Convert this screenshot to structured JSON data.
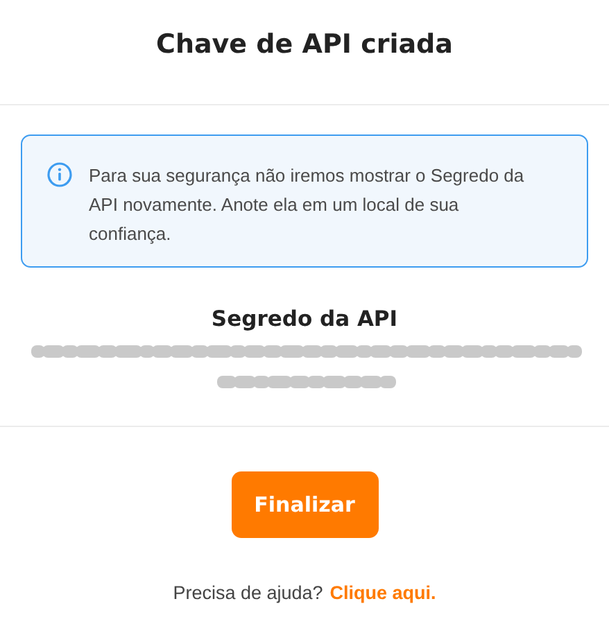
{
  "dialog": {
    "title": "Chave de API criada"
  },
  "notice": {
    "kind": "info",
    "text": "Para sua segurança não iremos mostrar o Segredo da API novamente. Anote ela em um local de sua confiança."
  },
  "secret": {
    "label": "Segredo da API"
  },
  "buttons": [
    {
      "label": "Finalizar"
    }
  ],
  "help": {
    "text": "Precisa de ajuda?",
    "link": "Clique aqui."
  }
}
